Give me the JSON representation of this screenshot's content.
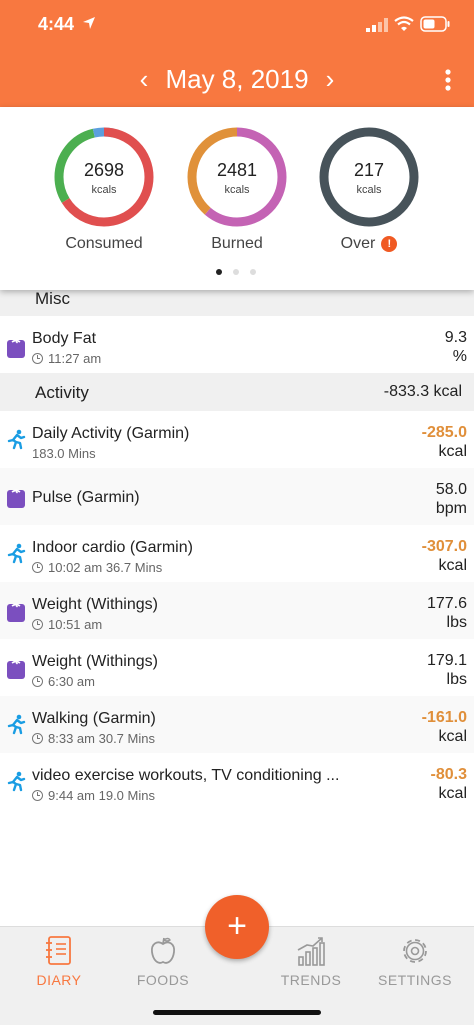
{
  "status_bar": {
    "time": "4:44"
  },
  "header": {
    "date": "May 8, 2019",
    "prev": "‹",
    "next": "›"
  },
  "summary": {
    "rings": [
      {
        "value": "2698",
        "unit": "kcals",
        "label": "Consumed"
      },
      {
        "value": "2481",
        "unit": "kcals",
        "label": "Burned"
      },
      {
        "value": "217",
        "unit": "kcals",
        "label": "Over",
        "badge": "!"
      }
    ],
    "page_count": 3,
    "active_page": 1
  },
  "sections": {
    "misc": {
      "title": "Misc"
    },
    "activity": {
      "title": "Activity",
      "total": "-833.3 kcal"
    }
  },
  "rows": [
    {
      "name": "Body Fat",
      "time": "11:27 am",
      "detail": "",
      "value": "9.3",
      "unit": "%",
      "icon": "scale-icon",
      "negative": false
    },
    {
      "name": "Daily Activity (Garmin)",
      "time": "",
      "detail": "183.0 Mins",
      "value": "-285.0",
      "unit": "kcal",
      "icon": "running-icon",
      "negative": true
    },
    {
      "name": "Pulse (Garmin)",
      "time": "",
      "detail": "",
      "value": "58.0",
      "unit": "bpm",
      "icon": "scale-icon",
      "negative": false
    },
    {
      "name": "Indoor cardio (Garmin)",
      "time": "10:02 am",
      "detail": "36.7 Mins",
      "value": "-307.0",
      "unit": "kcal",
      "icon": "running-icon",
      "negative": true
    },
    {
      "name": "Weight (Withings)",
      "time": "10:51 am",
      "detail": "",
      "value": "177.6",
      "unit": "lbs",
      "icon": "scale-icon",
      "negative": false
    },
    {
      "name": "Weight (Withings)",
      "time": "6:30 am",
      "detail": "",
      "value": "179.1",
      "unit": "lbs",
      "icon": "scale-icon",
      "negative": false
    },
    {
      "name": "Walking (Garmin)",
      "time": "8:33 am",
      "detail": "30.7 Mins",
      "value": "-161.0",
      "unit": "kcal",
      "icon": "running-icon",
      "negative": true
    },
    {
      "name": "video exercise workouts, TV conditioning ...",
      "time": "9:44 am",
      "detail": "19.0 Mins",
      "value": "-80.3",
      "unit": "kcal",
      "icon": "running-icon",
      "negative": true
    }
  ],
  "fab": {
    "label": "+"
  },
  "tabs": [
    {
      "label": "DIARY",
      "icon": "diary-icon",
      "active": true
    },
    {
      "label": "FOODS",
      "icon": "apple-icon",
      "active": false
    },
    {
      "label": "TRENDS",
      "icon": "trends-icon",
      "active": false
    },
    {
      "label": "SETTINGS",
      "icon": "gear-icon",
      "active": false
    }
  ],
  "colors": {
    "brand": "#f87840",
    "fab": "#f0602a",
    "negative_value": "#e08f3a",
    "consumed_ring": [
      "#4caf50",
      "#5c9fdd",
      "#e04f4f"
    ],
    "burned_ring": [
      "#e0913a",
      "#c463b4"
    ],
    "over_ring": "#47535a",
    "log_icon": "#7b4fbf",
    "activity_icon": "#1a9de3"
  }
}
